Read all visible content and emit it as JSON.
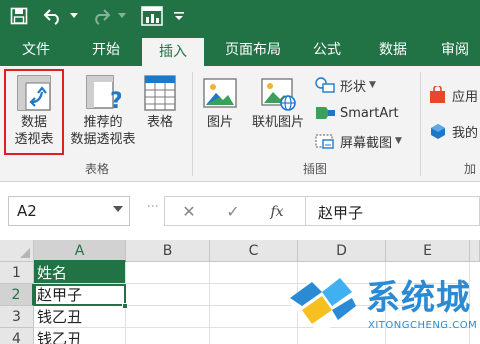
{
  "quick_access": {
    "icons": [
      "save-icon",
      "undo-icon",
      "redo-icon",
      "pivot-icon",
      "customize-icon"
    ]
  },
  "tabs": [
    {
      "label": "文件"
    },
    {
      "label": "开始"
    },
    {
      "label": "插入",
      "active": true
    },
    {
      "label": "页面布局"
    },
    {
      "label": "公式"
    },
    {
      "label": "数据"
    },
    {
      "label": "审阅"
    }
  ],
  "ribbon": {
    "tables_group": {
      "pivot_table_line1": "数据",
      "pivot_table_line2": "透视表",
      "recommended_line1": "推荐的",
      "recommended_line2": "数据透视表",
      "table": "表格",
      "label": "表格"
    },
    "illustrations_group": {
      "picture": "图片",
      "online_picture": "联机图片",
      "shapes": "形状",
      "smartart": "SmartArt",
      "screenshot": "屏幕截图",
      "label": "插图"
    },
    "addins_group": {
      "store": "应用",
      "my_addins": "我的",
      "label": "加"
    },
    "accent_color": "#217346",
    "highlight_color": "#e02020"
  },
  "formula_bar": {
    "name_box": "A2",
    "cancel_symbol": "✕",
    "enter_symbol": "✓",
    "fx_label": "fx",
    "content": "赵甲子"
  },
  "sheet": {
    "columns": [
      "A",
      "B",
      "C",
      "D",
      "E"
    ],
    "rows": [
      "1",
      "2",
      "3",
      "4"
    ],
    "cells": {
      "A1": "姓名",
      "A2": "赵甲子",
      "A3": "钱乙丑",
      "A4": "钱乙丑"
    },
    "selected_cell": "A2"
  },
  "watermark": {
    "title": "系统城",
    "url": "XITONGCHENG.COM"
  }
}
